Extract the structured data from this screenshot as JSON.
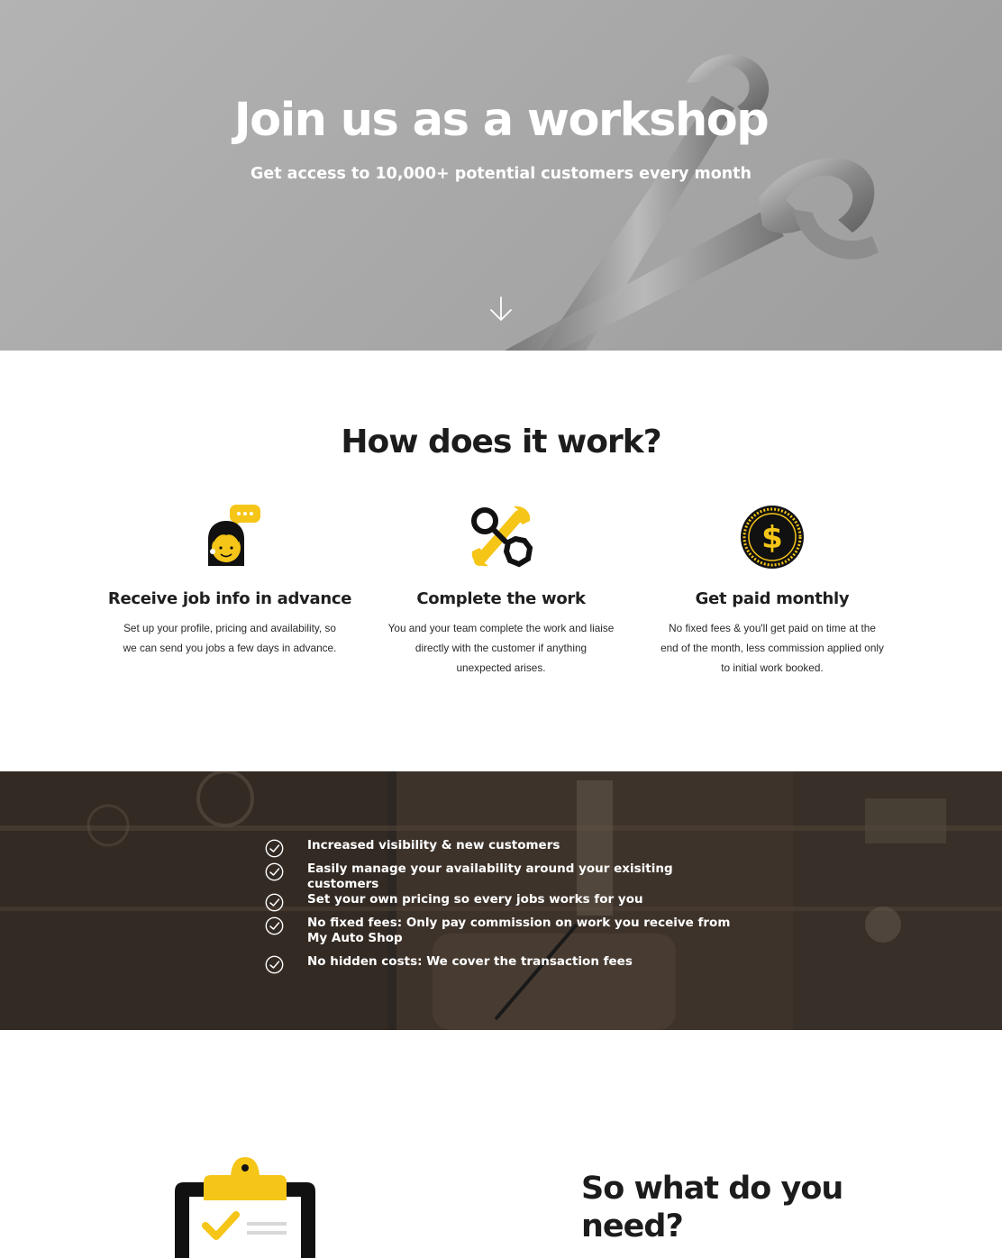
{
  "hero": {
    "title": "Join us as a workshop",
    "subtitle": "Get access to 10,000+ potential customers every month",
    "scroll_icon": "arrow-down-icon"
  },
  "how": {
    "title": "How does it work?",
    "steps": [
      {
        "icon": "support-agent-icon",
        "title": "Receive job info in advance",
        "text": "Set up your profile, pricing and availability, so we can send you jobs a few days in advance."
      },
      {
        "icon": "wrench-tools-icon",
        "title": "Complete the work",
        "text": "You and your team complete the work and liaise directly with the customer if anything unexpected arises."
      },
      {
        "icon": "dollar-coin-icon",
        "title": "Get paid monthly",
        "text": "No fixed fees & you'll get paid on time at the end of the month, less commission applied only to initial work booked."
      }
    ]
  },
  "benefits": {
    "icon": "check-circle-icon",
    "items": [
      "Increased visibility & new customers",
      "Easily manage your availability around your exisiting customers",
      "Set your own pricing so every jobs works for you",
      "No fixed fees: Only pay commission on work you receive from My Auto Shop",
      "No hidden costs: We cover the transaction fees"
    ]
  },
  "need": {
    "title": "So what do you need?",
    "icon": "clipboard-check-icon"
  },
  "colors": {
    "accent": "#f5c518",
    "dark": "#1a1a1a",
    "hero_overlay": "#a8a8a8"
  }
}
